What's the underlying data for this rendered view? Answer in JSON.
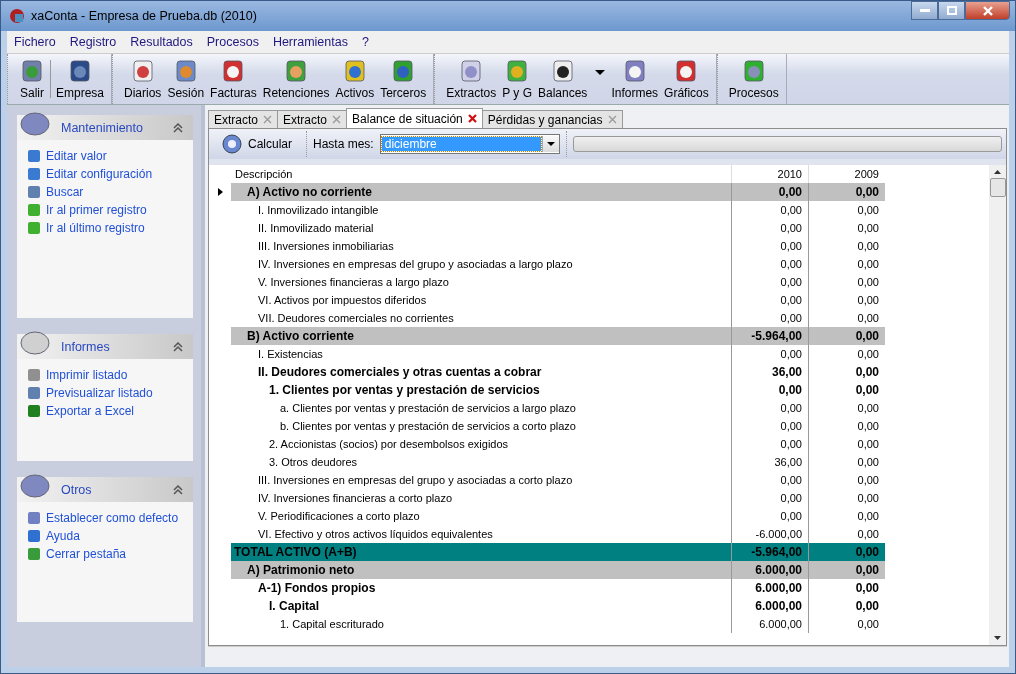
{
  "window": {
    "title": "xaConta - Empresa de Prueba.db (2010)"
  },
  "menu": [
    "Fichero",
    "Registro",
    "Resultados",
    "Procesos",
    "Herramientas",
    "?"
  ],
  "toolbar": {
    "groups": [
      [
        {
          "label": "Salir",
          "dropdown": false
        },
        {
          "label": "Empresa",
          "dropdown": false
        }
      ],
      [
        {
          "label": "Diarios",
          "dropdown": false
        },
        {
          "label": "Sesión",
          "dropdown": false
        },
        {
          "label": "Facturas",
          "dropdown": false
        },
        {
          "label": "Retenciones",
          "dropdown": false
        },
        {
          "label": "Activos",
          "dropdown": false
        },
        {
          "label": "Terceros",
          "dropdown": false
        }
      ],
      [
        {
          "label": "Extractos",
          "dropdown": false
        },
        {
          "label": "P y G",
          "dropdown": false
        },
        {
          "label": "Balances",
          "dropdown": true
        },
        {
          "label": "Informes",
          "dropdown": false
        },
        {
          "label": "Gráficos",
          "dropdown": false
        }
      ],
      [
        {
          "label": "Procesos",
          "dropdown": false
        }
      ]
    ]
  },
  "sidebar": {
    "panels": [
      {
        "title": "Mantenimiento",
        "expanded": true,
        "items": [
          "Editar valor",
          "Editar configuración",
          "Buscar",
          "Ir al primer registro",
          "Ir al último registro"
        ]
      },
      {
        "title": "Informes",
        "expanded": true,
        "items": [
          "Imprimir listado",
          "Previsualizar listado",
          "Exportar a Excel"
        ]
      },
      {
        "title": "Otros",
        "expanded": true,
        "items": [
          "Establecer como defecto",
          "Ayuda",
          "Cerrar pestaña"
        ]
      }
    ]
  },
  "tabs": [
    {
      "label": "Extracto",
      "selected": false
    },
    {
      "label": "Extracto",
      "selected": false
    },
    {
      "label": "Balance de situación",
      "selected": true
    },
    {
      "label": "Pérdidas y ganancias",
      "selected": false
    }
  ],
  "report_toolbar": {
    "button": "Calcular",
    "month_label": "Hasta mes:",
    "month": "diciembre",
    "progress": {
      "level": 0
    }
  },
  "table": {
    "columns": [
      "Descripción",
      "2010",
      "2009"
    ],
    "rows": [
      {
        "kind": "group",
        "label": "A) Activo no corriente",
        "values": [
          "0,00",
          "0,00"
        ],
        "selected": true,
        "children": [
          {
            "kind": "normal",
            "label": "I. Inmovilizado intangible",
            "values": [
              "0,00",
              "0,00"
            ],
            "selected": false
          },
          {
            "kind": "normal",
            "label": "II. Inmovilizado material",
            "values": [
              "0,00",
              "0,00"
            ],
            "selected": false
          },
          {
            "kind": "normal",
            "label": "III. Inversiones inmobiliarias",
            "values": [
              "0,00",
              "0,00"
            ],
            "selected": false
          },
          {
            "kind": "normal",
            "label": "IV. Inversiones en empresas del grupo y asociadas a largo plazo",
            "values": [
              "0,00",
              "0,00"
            ],
            "selected": false
          },
          {
            "kind": "normal",
            "label": "V. Inversiones financieras a largo plazo",
            "values": [
              "0,00",
              "0,00"
            ],
            "selected": false
          },
          {
            "kind": "normal",
            "label": "VI. Activos por impuestos diferidos",
            "values": [
              "0,00",
              "0,00"
            ],
            "selected": false
          },
          {
            "kind": "normal",
            "label": "VII. Deudores comerciales no corrientes",
            "values": [
              "0,00",
              "0,00"
            ],
            "selected": false
          }
        ]
      },
      {
        "kind": "group",
        "label": "B) Activo corriente",
        "values": [
          "-5.964,00",
          "0,00"
        ],
        "selected": false,
        "children": [
          {
            "kind": "normal",
            "label": "I. Existencias",
            "values": [
              "0,00",
              "0,00"
            ],
            "selected": false
          },
          {
            "kind": "bold",
            "label": "II. Deudores comerciales y otras cuentas a cobrar",
            "values": [
              "36,00",
              "0,00"
            ],
            "selected": false,
            "children": [
              {
                "kind": "bold",
                "label": "1. Clientes por ventas y prestación de servicios",
                "values": [
                  "0,00",
                  "0,00"
                ],
                "selected": false,
                "children": [
                  {
                    "kind": "normal",
                    "label": "a. Clientes por ventas y prestación de servicios a largo plazo",
                    "values": [
                      "0,00",
                      "0,00"
                    ],
                    "selected": false
                  },
                  {
                    "kind": "normal",
                    "label": "b. Clientes por ventas y prestación de servicios a corto plazo",
                    "values": [
                      "0,00",
                      "0,00"
                    ],
                    "selected": false
                  }
                ]
              },
              {
                "kind": "normal",
                "label": "2. Accionistas (socios) por desembolsos exigidos",
                "values": [
                  "0,00",
                  "0,00"
                ],
                "selected": false
              },
              {
                "kind": "normal",
                "label": "3. Otros deudores",
                "values": [
                  "36,00",
                  "0,00"
                ],
                "selected": false
              }
            ]
          },
          {
            "kind": "normal",
            "label": "III. Inversiones en empresas del grupo y asociadas a corto plazo",
            "values": [
              "0,00",
              "0,00"
            ],
            "selected": false
          },
          {
            "kind": "normal",
            "label": "IV. Inversiones financieras a corto plazo",
            "values": [
              "0,00",
              "0,00"
            ],
            "selected": false
          },
          {
            "kind": "normal",
            "label": "V. Periodificaciones a corto plazo",
            "values": [
              "0,00",
              "0,00"
            ],
            "selected": false
          },
          {
            "kind": "normal",
            "label": "VI. Efectivo y otros activos líquidos equivalentes",
            "values": [
              "-6.000,00",
              "0,00"
            ],
            "selected": false
          }
        ]
      },
      {
        "kind": "total",
        "label": "TOTAL ACTIVO (A+B)",
        "values": [
          "-5.964,00",
          "0,00"
        ],
        "selected": false
      },
      {
        "kind": "group",
        "label": "A) Patrimonio neto",
        "values": [
          "6.000,00",
          "0,00"
        ],
        "selected": false,
        "children": [
          {
            "kind": "bold",
            "label": "A-1) Fondos propios",
            "values": [
              "6.000,00",
              "0,00"
            ],
            "selected": false,
            "children": [
              {
                "kind": "bold",
                "label": "I. Capital",
                "values": [
                  "6.000,00",
                  "0,00"
                ],
                "selected": false,
                "children": [
                  {
                    "kind": "normal",
                    "label": "1. Capital escriturado",
                    "values": [
                      "6.000,00",
                      "0,00"
                    ],
                    "selected": false
                  }
                ]
              }
            ]
          }
        ]
      }
    ]
  }
}
